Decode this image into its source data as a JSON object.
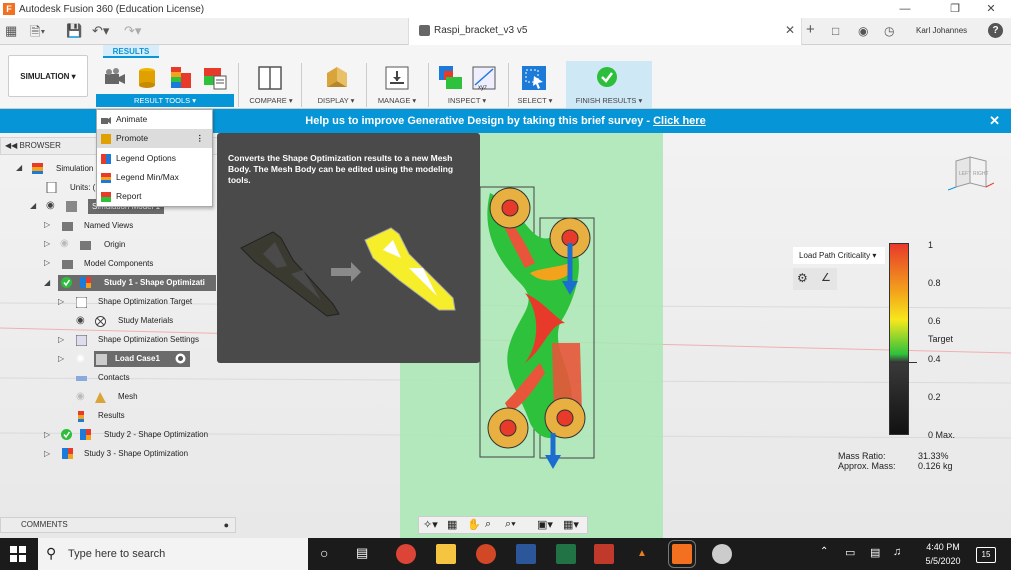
{
  "window": {
    "app_title": "Autodesk Fusion 360 (Education License)",
    "app_logo": "F"
  },
  "document": {
    "title": "Raspi_bracket_v3 v5"
  },
  "user": {
    "name": "Karl Johannes",
    "help": "?"
  },
  "ribbon": {
    "workspace": "SIMULATION ▾",
    "active_tab": "RESULTS",
    "groups": {
      "result_tools": "RESULT TOOLS ▾",
      "compare": "COMPARE ▾",
      "display": "DISPLAY ▾",
      "manage": "MANAGE ▾",
      "inspect": "INSPECT ▾",
      "select": "SELECT ▾",
      "finish": "FINISH RESULTS ▾"
    }
  },
  "banner": {
    "text": "Help us to improve Generative Design by taking this brief survey - ",
    "link": "Click here"
  },
  "dropdown": {
    "items": [
      "Animate",
      "Promote",
      "Legend Options",
      "Legend Min/Max",
      "Report"
    ]
  },
  "tooltip": {
    "text": "Converts the Shape Optimization results to a new Mesh Body. The Mesh Body can be edited using the modeling tools."
  },
  "browser": {
    "header": "BROWSER",
    "rows": {
      "simulation": "Simulation",
      "units": "Units: (",
      "model": "Simulation Model 1",
      "named_views": "Named Views",
      "origin": "Origin",
      "model_components": "Model Components",
      "study1": "Study 1 - Shape Optimizati",
      "target": "Shape Optimization Target",
      "materials": "Study Materials",
      "settings": "Shape Optimization Settings",
      "loadcase": "Load Case1",
      "contacts": "Contacts",
      "mesh": "Mesh",
      "results": "Results",
      "study2": "Study 2 - Shape Optimization",
      "study3": "Study 3 - Shape Optimization"
    }
  },
  "legend": {
    "selector": "Load Path Criticality ▾",
    "ticks": [
      "1",
      "0.8",
      "0.6",
      "Target",
      "0.4",
      "0.2",
      "0 Max."
    ],
    "mass_ratio_label": "Mass Ratio:",
    "mass_ratio_value": "31.33%",
    "approx_mass_label": "Approx. Mass:",
    "approx_mass_value": "0.126 kg"
  },
  "viewcube": {
    "face_left": "LEFT",
    "face_right": "RIGHT"
  },
  "comments": {
    "label": "COMMENTS"
  },
  "taskbar": {
    "search_placeholder": "Type here to search",
    "time": "4:40 PM",
    "date": "5/5/2020",
    "notifications": "15"
  },
  "colors": {
    "accent": "#0696d7",
    "finish_green": "#2dbe3c"
  }
}
